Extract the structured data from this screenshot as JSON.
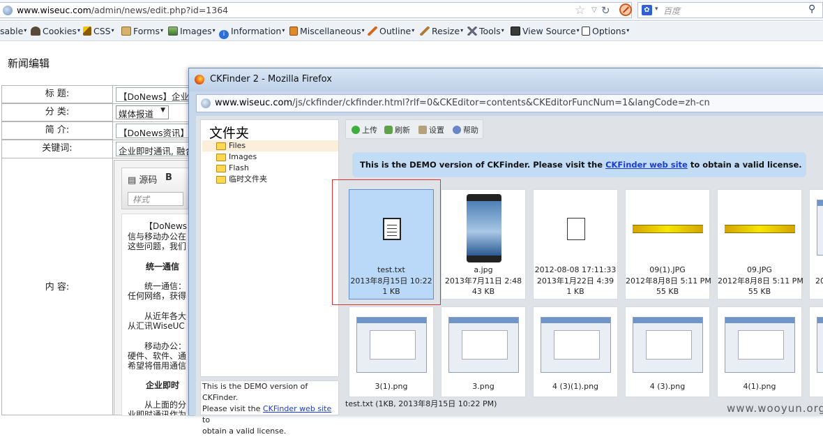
{
  "browser": {
    "url": "www.wiseuc.com/admin/news/edit.php?id=1364",
    "url_domain": "www.wiseuc.com",
    "url_path": "/admin/news/edit.php?id=1364",
    "search_placeholder": "百度"
  },
  "devtoolbar": {
    "items": [
      "sable",
      "Cookies",
      "CSS",
      "Forms",
      "Images",
      "Information",
      "Miscellaneous",
      "Outline",
      "Resize",
      "Tools",
      "View Source",
      "Options"
    ]
  },
  "page": {
    "title": "新闻编辑",
    "form": {
      "title_label": "标  题:",
      "title_value": "【DoNews】企业即",
      "category_label": "分  类:",
      "category_value": "媒体报道",
      "summary_label": "简  介:",
      "summary_value": "【DoNews资讯】如",
      "keywords_label": "关键词:",
      "keywords_value": "企业即时通讯, 融合",
      "content_label": "内  容:"
    },
    "editor": {
      "source_label": "源码",
      "bold_label": "B",
      "style_placeholder": "样式",
      "lines": [
        "【DoNews",
        "信与移动办公在",
        "这些问题，我们",
        "统一通信",
        "统一通信：",
        "任何网络，获得",
        "从近年各大",
        "从汇讯WiseUC",
        "移动办公：",
        "硬件、软件、通",
        "希望将借用通信",
        "企业即时",
        "从上面的分",
        "业即时通讯作为"
      ]
    }
  },
  "popup": {
    "window_title": "CKFinder 2 - Mozilla Firefox",
    "url_domain": "www.wiseuc.com",
    "url_path": "/js/ckfinder/ckfinder.html?rlf=0&CKEditor=contents&CKEditorFuncNum=1&langCode=zh-cn",
    "folders_title": "文件夹",
    "folders": [
      "Files",
      "Images",
      "Flash",
      "临时文件夹"
    ],
    "selected_folder": "Files",
    "demo_left_1": "This is the DEMO version of CKFinder.",
    "demo_left_2": "Please visit the",
    "demo_left_link": "CKFinder web site",
    "demo_left_3": "to",
    "demo_left_4": "obtain a valid license.",
    "toolbar": {
      "upload": "上传",
      "refresh": "刷新",
      "settings": "设置",
      "help": "帮助"
    },
    "demo_banner_pre": "This is the DEMO version of CKFinder. Please visit the",
    "demo_banner_link": "CKFinder web site",
    "demo_banner_post": "to obtain a valid license.",
    "files_row1": [
      {
        "name": "test.txt",
        "date": "2013年8月15日 10:22",
        "size": "1 KB",
        "kind": "text-file-icon"
      },
      {
        "name": "a.jpg",
        "date": "2013年7月11日 2:48",
        "size": "43 KB",
        "kind": "phone-thumbnail"
      },
      {
        "name": "2012-08-08 17:11:33",
        "date": "2013年1月22日 4:39",
        "size": "1 KB",
        "kind": "blank-file-icon"
      },
      {
        "name": "09(1).JPG",
        "date": "2012年8月8日 5:11 PM",
        "size": "55 KB",
        "kind": "banner-thumbnail"
      },
      {
        "name": "09.JPG",
        "date": "2012年8月8日 5:11 PM",
        "size": "55 KB",
        "kind": "banner-thumbnail"
      },
      {
        "name": "",
        "date": "20",
        "size": "",
        "kind": "screenshot-thumbnail"
      }
    ],
    "files_row2": [
      "3(1).png",
      "3.png",
      "4 (3)(1).png",
      "4 (3).png",
      "4(1).png",
      ""
    ],
    "status": "test.txt (1KB, 2013年8月15日 10:22 PM)"
  },
  "watermark": "www.wooyun.org"
}
